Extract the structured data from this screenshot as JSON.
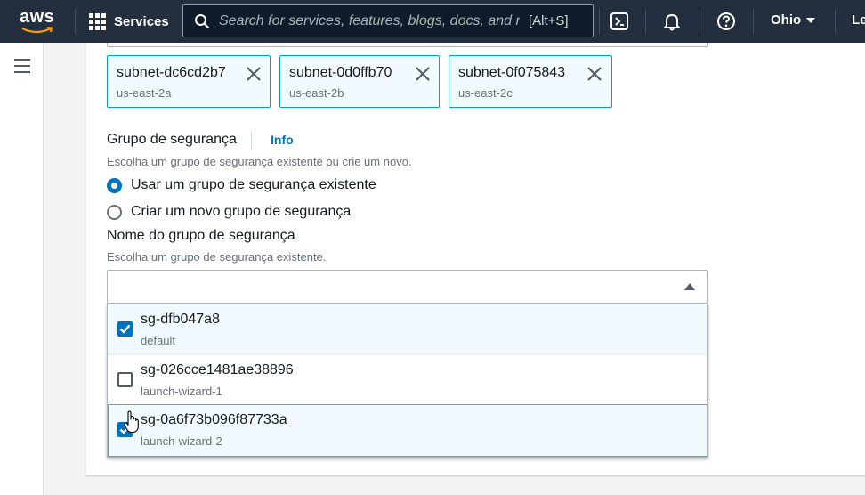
{
  "topnav": {
    "logo_text": "aws",
    "services_label": "Services",
    "search_placeholder": "Search for services, features, blogs, docs, and more",
    "search_shortcut": "[Alt+S]",
    "icons": [
      "cloudshell-icon",
      "bell-icon",
      "help-icon"
    ],
    "region": "Ohio",
    "user_partial": "Le"
  },
  "subnets": [
    {
      "id": "subnet-dc6cd2b7",
      "az": "us-east-2a"
    },
    {
      "id": "subnet-0d0ffb70",
      "az": "us-east-2b"
    },
    {
      "id": "subnet-0f075843",
      "az": "us-east-2c"
    }
  ],
  "security_group": {
    "label": "Grupo de segurança",
    "info": "Info",
    "description": "Escolha um grupo de segurança existente ou crie um novo.",
    "options": [
      {
        "label": "Usar um grupo de segurança existente",
        "selected": true
      },
      {
        "label": "Criar um novo grupo de segurança",
        "selected": false
      }
    ]
  },
  "sg_name": {
    "label": "Nome do grupo de segurança",
    "description": "Escolha um grupo de segurança existente.",
    "input_value": "",
    "items": [
      {
        "id": "sg-dfb047a8",
        "name": "default",
        "checked": true
      },
      {
        "id": "sg-026cce1481ae38896",
        "name": "launch-wizard-1",
        "checked": false
      },
      {
        "id": "sg-0a6f73b096f87733a",
        "name": "launch-wizard-2",
        "checked": true
      }
    ]
  },
  "colors": {
    "nav_bg": "#232f3e",
    "accent": "#0073bb",
    "token_border": "#00a1c9",
    "token_bg": "#f1faff"
  }
}
